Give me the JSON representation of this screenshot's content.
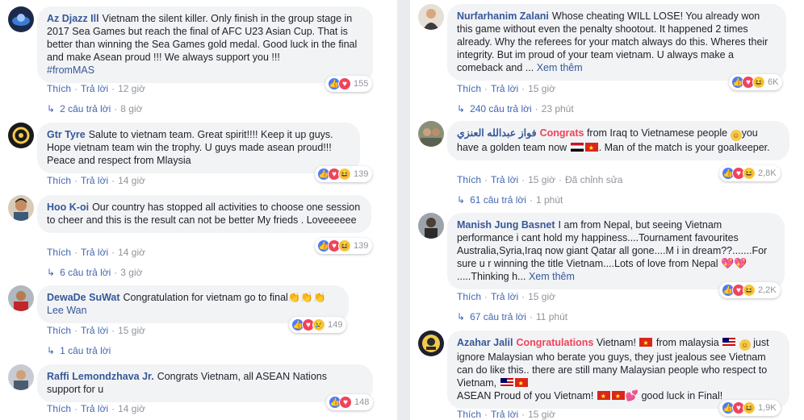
{
  "left_column": {
    "comments": [
      {
        "author": "Az Djazz Ill",
        "text": "Vietnam the silent killer. Only finish in the group stage in 2017 Sea Games but reach the final of AFC U23 Asian Cup. That is better than winning the Sea Games gold medal. Good luck in the final and make Asean proud !!! We always support you !!!",
        "tag": "#fromMAS",
        "like_label": "Thích",
        "reply_label": "Trả lời",
        "time": "12 giờ",
        "reaction_count": "155",
        "replies_label": "2 câu trả lời",
        "replies_time": "8 giờ"
      },
      {
        "author": "Gtr Tyre",
        "text": "Salute to vietnam team. Great spirit!!!! Keep it up guys. Hope vietnam team win the trophy. U guys made asean proud!!! Peace and respect from Mlaysia",
        "like_label": "Thích",
        "reply_label": "Trả lời",
        "time": "14 giờ",
        "reaction_count": "139"
      },
      {
        "author": "Hoo K-oi",
        "text": "Our country has stopped all activities to choose one session to cheer and this is the result can not be better My frieds . Loveeeeee",
        "like_label": "Thích",
        "reply_label": "Trả lời",
        "time": "14 giờ",
        "reaction_count": "139",
        "replies_label": "6 câu trả lời",
        "replies_time": "3 giờ"
      },
      {
        "author": "DewaDe SuWat",
        "text": "Congratulation for vietnam go to final",
        "text2": "Lee Wan",
        "like_label": "Thích",
        "reply_label": "Trả lời",
        "time": "15 giờ",
        "reaction_count": "149",
        "replies_label": "1 câu trả lời"
      },
      {
        "author": "Raffi Lemondzhava Jr.",
        "text": "Congrats Vietnam, all ASEAN Nations support for u",
        "like_label": "Thích",
        "reply_label": "Trả lời",
        "time": "14 giờ",
        "reaction_count": "148"
      }
    ]
  },
  "right_column": {
    "comments": [
      {
        "author": "Nurfarhanim Zalani",
        "text": "Whose cheating WILL LOSE! You already won this game without even the penalty shootout. It happened 2 times already. Why the referees for your match always do this. Wheres their integrity. But im proud of your team vietnam. U always make a comeback and ...",
        "see_more": "Xem thêm",
        "like_label": "Thích",
        "reply_label": "Trả lời",
        "time": "15 giờ",
        "reaction_count": "6K",
        "replies_label": "240 câu trả lời",
        "replies_time": "23 phút"
      },
      {
        "author": "فواز عبدالله العنزي",
        "highlight": "Congrats",
        "text_a": "from Iraq to Vietnamese people",
        "text_b": "you have a golden team now",
        "text_c": ". Man of the match is your goalkeeper.",
        "like_label": "Thích",
        "reply_label": "Trả lời",
        "time": "15 giờ",
        "edited": "Đã chỉnh sửa",
        "reaction_count": "2,8K",
        "replies_label": "61 câu trả lời",
        "replies_time": "1 phút"
      },
      {
        "author": "Manish Jung Basnet",
        "text": "I am from Nepal, but seeing Vietnam performance i cant hold my happiness....Tournament favourites Australia,Syria,Iraq now giant Qatar all gone....M i in dream??.......For sure u r winning the title Vietnam....Lots of love from Nepal",
        "text_tail": ".....Thinking h...",
        "see_more": "Xem thêm",
        "like_label": "Thích",
        "reply_label": "Trả lời",
        "time": "15 giờ",
        "reaction_count": "2,2K",
        "replies_label": "67 câu trả lời",
        "replies_time": "11 phút"
      },
      {
        "author": "Azahar Jalil",
        "highlight": "Congratulations",
        "text_a": "Vietnam!",
        "text_b": "from malaysia",
        "text_c": "just ignore Malaysian who berate you guys, they just jealous see Vietnam can do like this.. there are still many Malaysian people who respect to Vietnam,",
        "text_d": "ASEAN Proud of you Vietnam!",
        "text_e": "good luck in Final!",
        "like_label": "Thích",
        "reply_label": "Trả lời",
        "time": "15 giờ",
        "reaction_count": "1,9K"
      }
    ]
  },
  "colors": {
    "link": "#365899",
    "meta": "#90949c",
    "bubble": "#f2f3f5",
    "highlight": "#f0435a"
  }
}
